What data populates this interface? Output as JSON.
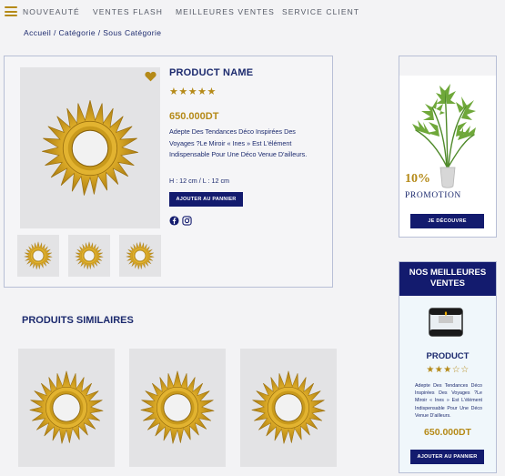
{
  "nav": {
    "items": [
      "NOUVEAUTÉ",
      "VENTES FLASH",
      "MEILLEURES VENTES",
      "SERVICE CLIENT"
    ]
  },
  "breadcrumb": "Accueil / Catégorie / Sous Catégorie",
  "product": {
    "name": "PRODUCT NAME",
    "rating": 5,
    "stars": "★★★★★",
    "price": "650.000DT",
    "description": "Adepte Des Tendances Déco Inspirées Des Voyages ?Le Miroir « Ines » Est L'élément Indispensable Pour Une Déco Venue D'ailleurs.",
    "dimensions": "H : 12 cm / L : 12 cm",
    "add_to_cart": "AJOUTER AU PANNIER",
    "social": [
      "facebook-icon",
      "instagram-icon"
    ]
  },
  "similar": {
    "title": "PRODUITS SIMILAIRES"
  },
  "promo": {
    "percent": "10%",
    "label": "PROMOTION",
    "button": "JE DÉCOUVRE"
  },
  "best": {
    "title": "NOS MEILLEURES VENTES",
    "name": "PRODUCT",
    "rating": 3.5,
    "stars": "★★★☆☆",
    "description": "Adepte Des Tendances Déco Inspirées Des Voyages ?Le Miroir « Ines » Est L'élément Indispensable Pour Une Déco Venue D'ailleurs.",
    "price": "650.000DT",
    "button": "AJOUTER AU PANNIER"
  },
  "colors": {
    "navy": "#131b6e",
    "gold": "#b58a18",
    "text": "#1c2a6e",
    "card_bg": "#e3e3e5"
  }
}
